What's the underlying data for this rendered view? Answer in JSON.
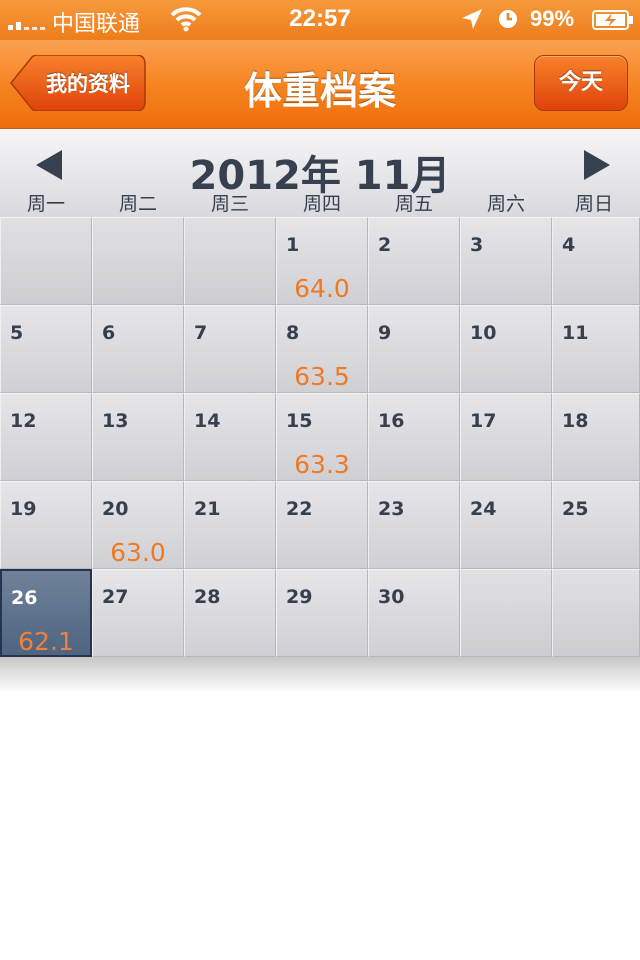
{
  "status_bar": {
    "carrier": "中国联通",
    "time": "22:57",
    "battery": "99%"
  },
  "nav": {
    "back_label": "我的资料",
    "title": "体重档案",
    "today_label": "今天"
  },
  "calendar": {
    "month_title": "2012年 11月",
    "weekdays": [
      "周一",
      "周二",
      "周三",
      "周四",
      "周五",
      "周六",
      "周日"
    ],
    "selected_day": "26",
    "weeks": [
      [
        {
          "day": "",
          "weight": ""
        },
        {
          "day": "",
          "weight": ""
        },
        {
          "day": "",
          "weight": ""
        },
        {
          "day": "1",
          "weight": "64.0"
        },
        {
          "day": "2",
          "weight": ""
        },
        {
          "day": "3",
          "weight": ""
        },
        {
          "day": "4",
          "weight": ""
        }
      ],
      [
        {
          "day": "5",
          "weight": ""
        },
        {
          "day": "6",
          "weight": ""
        },
        {
          "day": "7",
          "weight": ""
        },
        {
          "day": "8",
          "weight": "63.5"
        },
        {
          "day": "9",
          "weight": ""
        },
        {
          "day": "10",
          "weight": ""
        },
        {
          "day": "11",
          "weight": ""
        }
      ],
      [
        {
          "day": "12",
          "weight": ""
        },
        {
          "day": "13",
          "weight": ""
        },
        {
          "day": "14",
          "weight": ""
        },
        {
          "day": "15",
          "weight": "63.3"
        },
        {
          "day": "16",
          "weight": ""
        },
        {
          "day": "17",
          "weight": ""
        },
        {
          "day": "18",
          "weight": ""
        }
      ],
      [
        {
          "day": "19",
          "weight": ""
        },
        {
          "day": "20",
          "weight": "63.0"
        },
        {
          "day": "21",
          "weight": ""
        },
        {
          "day": "22",
          "weight": ""
        },
        {
          "day": "23",
          "weight": ""
        },
        {
          "day": "24",
          "weight": ""
        },
        {
          "day": "25",
          "weight": ""
        }
      ],
      [
        {
          "day": "26",
          "weight": "62.1"
        },
        {
          "day": "27",
          "weight": ""
        },
        {
          "day": "28",
          "weight": ""
        },
        {
          "day": "29",
          "weight": ""
        },
        {
          "day": "30",
          "weight": ""
        },
        {
          "day": "",
          "weight": ""
        },
        {
          "day": "",
          "weight": ""
        }
      ]
    ]
  },
  "icons": {
    "prev": "triangle-left-icon",
    "next": "triangle-right-icon",
    "wifi": "wifi-icon",
    "location": "location-arrow-icon",
    "alarm": "alarm-clock-icon",
    "battery": "battery-charging-icon"
  },
  "colors": {
    "nav_orange": "#f5821e",
    "weight_orange": "#ef7a26",
    "text_dark": "#36404f",
    "selected_cell": "#5a6e88"
  }
}
